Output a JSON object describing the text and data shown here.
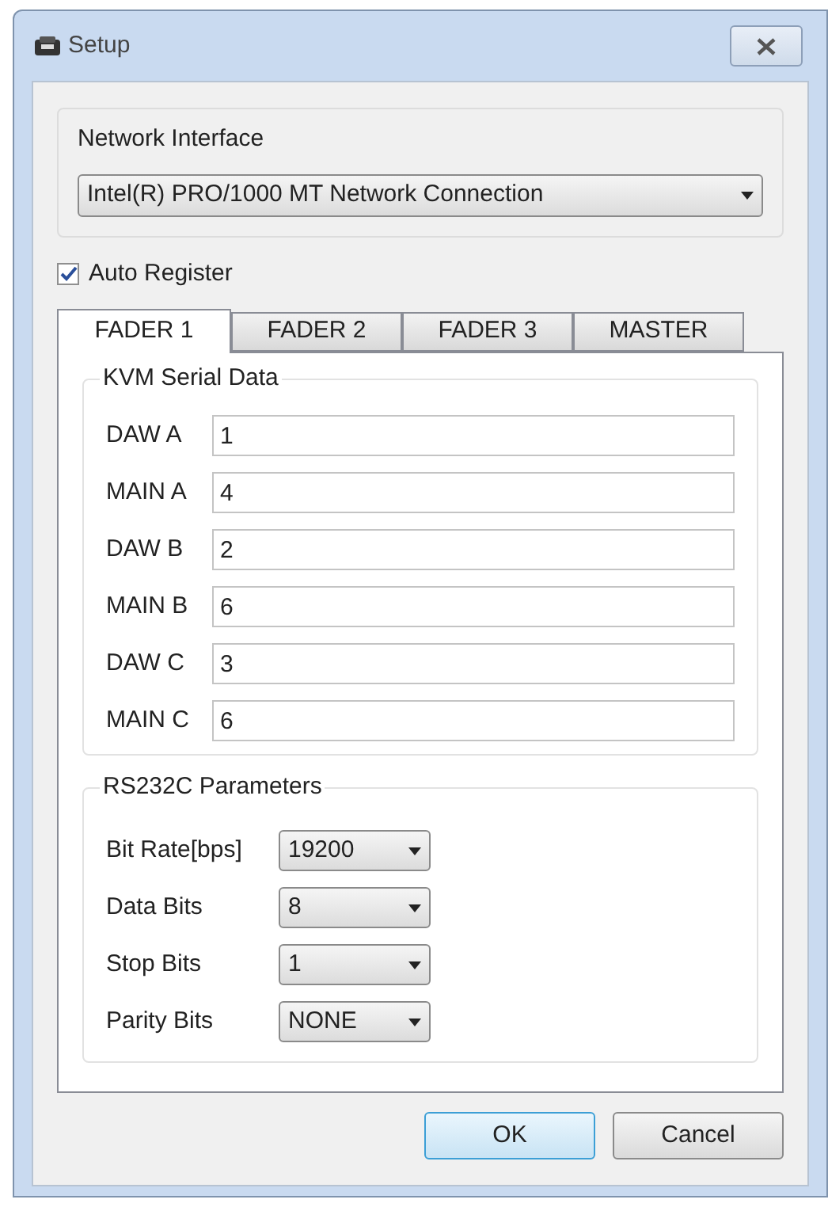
{
  "window": {
    "title": "Setup"
  },
  "network_interface": {
    "label": "Network Interface",
    "value": "Intel(R) PRO/1000 MT Network Connection"
  },
  "auto_register": {
    "label": "Auto Register",
    "checked": true
  },
  "tabs": [
    {
      "label": "FADER 1",
      "selected": true
    },
    {
      "label": "FADER 2",
      "selected": false
    },
    {
      "label": "FADER 3",
      "selected": false
    },
    {
      "label": "MASTER",
      "selected": false
    }
  ],
  "kvm_serial_data": {
    "title": "KVM Serial Data",
    "fields": [
      {
        "label": "DAW A",
        "value": "1"
      },
      {
        "label": "MAIN A",
        "value": "4"
      },
      {
        "label": "DAW B",
        "value": "2"
      },
      {
        "label": "MAIN B",
        "value": "6"
      },
      {
        "label": "DAW C",
        "value": "3"
      },
      {
        "label": "MAIN C",
        "value": "6"
      }
    ]
  },
  "rs232c_parameters": {
    "title": "RS232C Parameters",
    "fields": [
      {
        "label": "Bit Rate[bps]",
        "value": "19200"
      },
      {
        "label": "Data Bits",
        "value": "8"
      },
      {
        "label": "Stop Bits",
        "value": "1"
      },
      {
        "label": "Parity Bits",
        "value": "NONE"
      }
    ]
  },
  "buttons": [
    {
      "label": "OK",
      "default": true
    },
    {
      "label": "Cancel",
      "default": false
    }
  ]
}
